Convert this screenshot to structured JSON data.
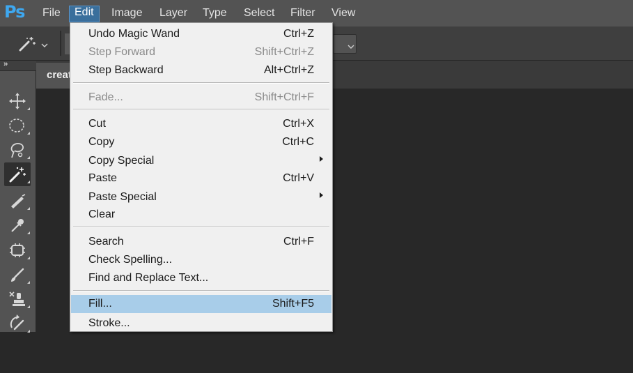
{
  "app": {
    "logo": "Ps"
  },
  "menubar": {
    "items": [
      {
        "label": "File"
      },
      {
        "label": "Edit"
      },
      {
        "label": "Image"
      },
      {
        "label": "Layer"
      },
      {
        "label": "Type"
      },
      {
        "label": "Select"
      },
      {
        "label": "Filter"
      },
      {
        "label": "View"
      }
    ],
    "active_item": "Edit"
  },
  "options_bar": {
    "tool_icon": "magic-wand-icon",
    "preset_dropdown": "chevron-down-icon",
    "right_dropdown": "chevron-down-icon"
  },
  "document": {
    "tab_label": "create"
  },
  "toolbox": {
    "collapse_icon": "double-chevron-right-icon",
    "tools": [
      {
        "icon": "move-icon",
        "selected": false
      },
      {
        "icon": "elliptical-marquee-icon",
        "selected": false
      },
      {
        "icon": "lasso-icon",
        "selected": false
      },
      {
        "icon": "magic-wand-icon",
        "selected": true
      },
      {
        "icon": "crop-icon",
        "selected": false
      },
      {
        "icon": "eyedropper-icon",
        "selected": false
      },
      {
        "icon": "patch-icon",
        "selected": false
      },
      {
        "icon": "brush-icon",
        "selected": false
      },
      {
        "icon": "clone-stamp-icon",
        "selected": false
      },
      {
        "icon": "history-brush-icon",
        "selected": false
      }
    ]
  },
  "edit_menu": {
    "items": [
      {
        "label": "Undo Magic Wand",
        "shortcut": "Ctrl+Z"
      },
      {
        "label": "Step Forward",
        "shortcut": "Shift+Ctrl+Z",
        "disabled": true
      },
      {
        "label": "Step Backward",
        "shortcut": "Alt+Ctrl+Z"
      },
      {
        "label": "Fade...",
        "shortcut": "Shift+Ctrl+F",
        "disabled": true
      },
      {
        "label": "Cut",
        "shortcut": "Ctrl+X"
      },
      {
        "label": "Copy",
        "shortcut": "Ctrl+C"
      },
      {
        "label": "Copy Special",
        "shortcut": "",
        "submenu": true
      },
      {
        "label": "Paste",
        "shortcut": "Ctrl+V"
      },
      {
        "label": "Paste Special",
        "shortcut": "",
        "submenu": true
      },
      {
        "label": "Clear",
        "shortcut": ""
      },
      {
        "label": "Search",
        "shortcut": "Ctrl+F"
      },
      {
        "label": "Check Spelling...",
        "shortcut": ""
      },
      {
        "label": "Find and Replace Text...",
        "shortcut": ""
      },
      {
        "label": "Fill...",
        "shortcut": "Shift+F5",
        "highlighted": true
      },
      {
        "label": "Stroke...",
        "shortcut": ""
      }
    ]
  },
  "colors": {
    "menubar_bg": "#535353",
    "workspace_bg": "#282828",
    "menu_bg": "#f0f0f0",
    "menu_highlight": "#a8cde9",
    "active_menu_bg": "#3a6f9c",
    "logo_blue": "#3ea8f0"
  }
}
